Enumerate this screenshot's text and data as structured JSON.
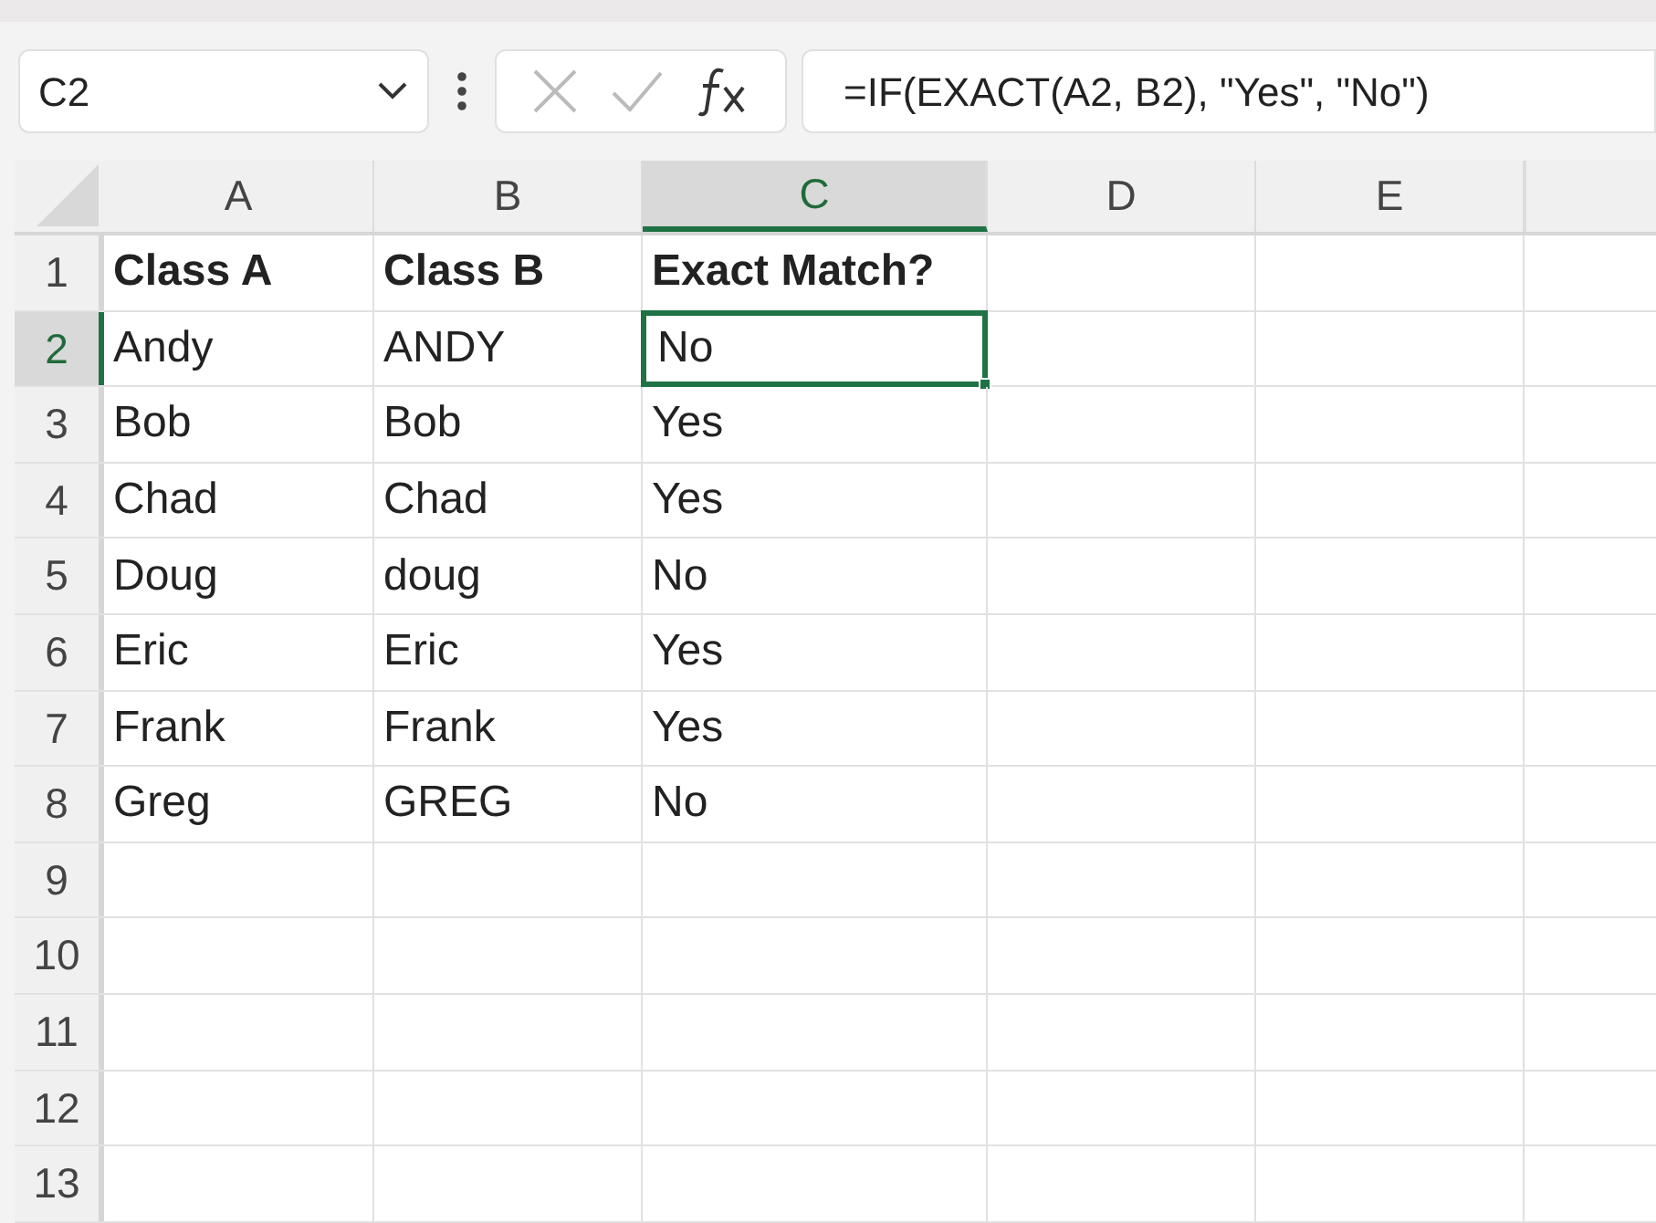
{
  "name_box": {
    "value": "C2"
  },
  "formula_bar": {
    "value": "=IF(EXACT(A2, B2), \"Yes\", \"No\")"
  },
  "columns": [
    {
      "label": "A",
      "selected": false
    },
    {
      "label": "B",
      "selected": false
    },
    {
      "label": "C",
      "selected": true
    },
    {
      "label": "D",
      "selected": false
    },
    {
      "label": "E",
      "selected": false
    }
  ],
  "rows": [
    {
      "label": "1",
      "selected": false,
      "kind": "header",
      "cells": [
        {
          "text": "Class A",
          "selected": false
        },
        {
          "text": "Class B",
          "selected": false
        },
        {
          "text": "Exact Match?",
          "selected": false
        }
      ]
    },
    {
      "label": "2",
      "selected": true,
      "kind": "data",
      "cells": [
        {
          "text": "Andy",
          "selected": false
        },
        {
          "text": "ANDY",
          "selected": false
        },
        {
          "text": "No",
          "selected": true
        }
      ]
    },
    {
      "label": "3",
      "selected": false,
      "kind": "data",
      "cells": [
        {
          "text": "Bob",
          "selected": false
        },
        {
          "text": "Bob",
          "selected": false
        },
        {
          "text": "Yes",
          "selected": false
        }
      ]
    },
    {
      "label": "4",
      "selected": false,
      "kind": "data",
      "cells": [
        {
          "text": "Chad",
          "selected": false
        },
        {
          "text": "Chad",
          "selected": false
        },
        {
          "text": "Yes",
          "selected": false
        }
      ]
    },
    {
      "label": "5",
      "selected": false,
      "kind": "data",
      "cells": [
        {
          "text": "Doug",
          "selected": false
        },
        {
          "text": "doug",
          "selected": false
        },
        {
          "text": "No",
          "selected": false
        }
      ]
    },
    {
      "label": "6",
      "selected": false,
      "kind": "data",
      "cells": [
        {
          "text": "Eric",
          "selected": false
        },
        {
          "text": "Eric",
          "selected": false
        },
        {
          "text": "Yes",
          "selected": false
        }
      ]
    },
    {
      "label": "7",
      "selected": false,
      "kind": "data",
      "cells": [
        {
          "text": "Frank",
          "selected": false
        },
        {
          "text": "Frank",
          "selected": false
        },
        {
          "text": "Yes",
          "selected": false
        }
      ]
    },
    {
      "label": "8",
      "selected": false,
      "kind": "data",
      "cells": [
        {
          "text": "Greg",
          "selected": false
        },
        {
          "text": "GREG",
          "selected": false
        },
        {
          "text": "No",
          "selected": false
        }
      ]
    },
    {
      "label": "9",
      "selected": false
    },
    {
      "label": "10",
      "selected": false
    },
    {
      "label": "11",
      "selected": false
    },
    {
      "label": "12",
      "selected": false
    },
    {
      "label": "13",
      "selected": false
    }
  ]
}
